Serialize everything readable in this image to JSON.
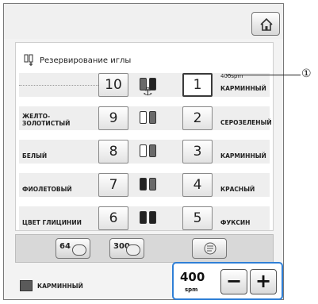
{
  "header": {
    "home_icon": "home-icon"
  },
  "title": {
    "icon": "needle-reserve-icon",
    "text": "Резервирование иглы"
  },
  "rows": [
    {
      "left_name": "",
      "left_num": "10",
      "right_num": "1",
      "right_name": "КАРМИННЫЙ",
      "right_spm": "400spm",
      "spools": [
        "gray",
        "dark"
      ],
      "selected_right": true
    },
    {
      "left_name": "ЖЕЛТО-\nЗОЛОТИСТЫЙ",
      "left_num": "9",
      "right_num": "2",
      "right_name": "СЕРОЗЕЛЕНЫЙ",
      "spools": [
        "light",
        "gray"
      ]
    },
    {
      "left_name": "БЕЛЫЙ",
      "left_num": "8",
      "right_num": "3",
      "right_name": "КАРМИННЫЙ",
      "spools": [
        "light",
        "gray"
      ]
    },
    {
      "left_name": "ФИОЛЕТОВЫЙ",
      "left_num": "7",
      "right_num": "4",
      "right_name": "КРАСНЫЙ",
      "spools": [
        "dark",
        "gray"
      ]
    },
    {
      "left_name": "ЦВЕТ ГЛИЦИНИИ",
      "left_num": "6",
      "right_num": "5",
      "right_name": "ФУКСИН",
      "spools": [
        "dark",
        "dark"
      ]
    }
  ],
  "toolbar": {
    "btn64": "64",
    "btn300": "300",
    "third_icon": "thread-reset-icon"
  },
  "current": {
    "color_name": "КАРМИННЫЙ"
  },
  "speed": {
    "value": "400",
    "unit": "spm",
    "minus": "−",
    "plus": "+"
  },
  "callout": "①"
}
